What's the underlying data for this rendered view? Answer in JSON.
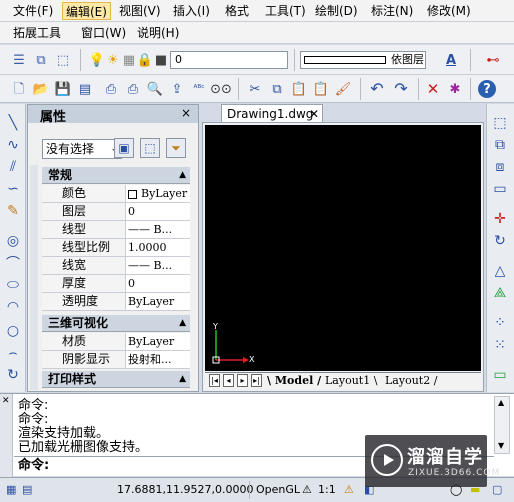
{
  "menu": {
    "row1": [
      "文件(F)",
      "编辑(E)",
      "视图(V)",
      "插入(I)",
      "格式",
      "工具(T)",
      "绘制(D)",
      "标注(N)",
      "修改(M)"
    ],
    "row2": [
      "拓展工具",
      "窗口(W)",
      "说明(H)"
    ],
    "active_index": 1
  },
  "layer_toolbar": {
    "layer_value": "0",
    "color_value": "依图层"
  },
  "properties": {
    "title": "属性",
    "close": "×",
    "selection": "没有选择",
    "sections": {
      "general": "常规",
      "threed": "三维可视化",
      "print": "打印样式"
    },
    "general_rows": [
      {
        "key": "颜色",
        "value": "ByLayer"
      },
      {
        "key": "图层",
        "value": "0"
      },
      {
        "key": "线型",
        "value": "—— B..."
      },
      {
        "key": "线型比例",
        "value": "1.0000"
      },
      {
        "key": "线宽",
        "value": "—— B..."
      },
      {
        "key": "厚度",
        "value": "0"
      },
      {
        "key": "透明度",
        "value": "ByLayer"
      }
    ],
    "threed_rows": [
      {
        "key": "材质",
        "value": "ByLayer"
      },
      {
        "key": "阴影显示",
        "value": "投射和..."
      }
    ]
  },
  "document": {
    "tab_name": "Drawing1.dwg",
    "tab_close": "✕",
    "ucs_y": "Y",
    "ucs_x": "X",
    "layout_tabs": [
      "Model",
      "Layout1",
      "Layout2"
    ]
  },
  "command": {
    "lines": [
      "命令:",
      "命令:",
      "渲染支持加载。",
      "已加载光栅图像支持。"
    ],
    "prompt": "命令:"
  },
  "status": {
    "coords": "17.6881,11.9527,0.0000",
    "opengl": "OpenGL",
    "scale": "1:1"
  },
  "watermark": {
    "main": "溜溜自学",
    "sub": "ZIXUE.3D66.COM"
  },
  "colors": {
    "canvas": "#000000",
    "active_menu": "#ffe9a8",
    "ucs_red": "#e02020",
    "ucs_green": "#20c020"
  }
}
